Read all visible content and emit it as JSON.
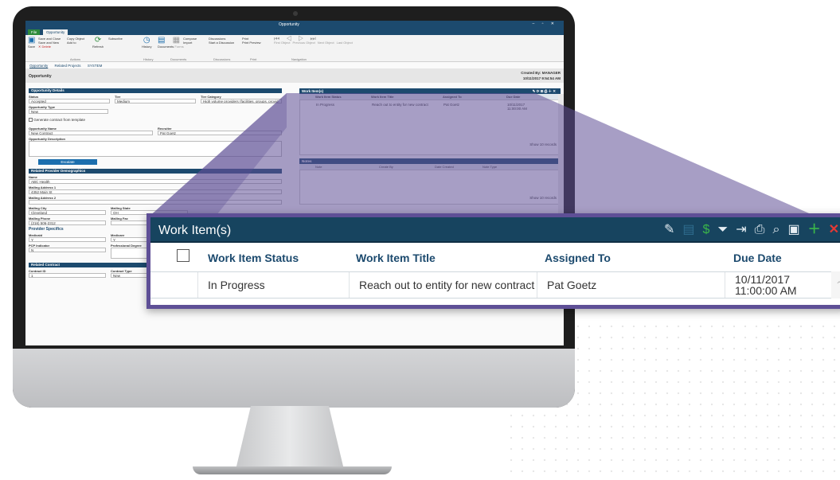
{
  "app": {
    "window_title": "Opportunity",
    "tabs": {
      "file": "File",
      "opportunity": "Opportunity"
    },
    "ribbon": {
      "save": "Save",
      "save_close": "Save and Close",
      "copy_object": "Copy Object",
      "subscribe": "Subscribe",
      "save_new": "Save and New",
      "add_to": "Add to",
      "delete": "Delete",
      "refresh": "Refresh",
      "history": "History",
      "documents": "Documents",
      "forms": "Forms",
      "compose": "Compose",
      "import": "Import",
      "discussions": "Discussions",
      "start_discussion": "Start a Discussion",
      "print": "Print",
      "print_preview": "Print Preview",
      "first_object": "First Object",
      "previous_object": "Previous Object",
      "next_object": "Next Object",
      "last_object": "Last Object",
      "groups": {
        "actions": "Actions",
        "history": "History",
        "documents": "Documents",
        "discussions": "Discussions",
        "print": "Print",
        "navigation": "Navigation"
      }
    },
    "subtabs": [
      "Opportunity",
      "Related Projects",
      "SYSTEM"
    ],
    "header": {
      "title": "Opportunity",
      "created_by": "Created By: MANAGER",
      "created_on": "10/11/2017 9:54:54 AM"
    },
    "details": {
      "section": "Opportunity Details",
      "status_label": "Status",
      "status_value": "Accepted",
      "tier_label": "Tier",
      "tier_value": "Medium",
      "tier_category_label": "Tier Category",
      "tier_category_value": "High volume providers (facilities, groups, provid",
      "type_label": "Opportunity Type",
      "type_value": "New",
      "generate_contract": "Generate contract from template",
      "name_label": "Opportunity Name",
      "name_value": "New Contract",
      "recruiter_label": "Recruiter",
      "recruiter_value": "Pat Goetz",
      "description_label": "Opportunity Description",
      "escalate_button": "Escalate"
    },
    "demographics": {
      "section": "Related Provider Demographics",
      "name_label": "Name",
      "name_value": "ABC Health",
      "address1_label": "Mailing Address 1",
      "address1_value": "4352 Main St",
      "address2_label": "Mailing Address 2",
      "city_label": "Mailing City",
      "city_value": "Cleveland",
      "state_label": "Mailing State",
      "state_value": "OH",
      "phone_label": "Mailing Phone",
      "phone_value": "(216) 506-2312",
      "fax_label": "Mailing Fax",
      "specifics_title": "Provider Specifics",
      "medicaid_label": "Medicaid",
      "medicaid_value": "Y",
      "medicare_label": "Medicare",
      "medicare_value": "Y",
      "pcp_label": "PCP Indicator",
      "pcp_value": "N",
      "degree_label": "Professional Degree"
    },
    "contract": {
      "section": "Related Contract",
      "id_label": "Contract ID",
      "id_value": "1",
      "type_label": "Contract Type",
      "type_value": "New"
    },
    "mini_work_items": {
      "title": "Work Item(s)",
      "columns": [
        "Work Item Status",
        "Work Item Title",
        "Assigned To",
        "Due Date"
      ],
      "row": [
        "In Progress",
        "Reach out to entity for new contract",
        "Pat Goetz",
        "10/11/2017 11:00:00 AM"
      ],
      "footer": "Show 10 records"
    },
    "mini_notes": {
      "title": "Notes",
      "columns": [
        "Note",
        "Create By",
        "Date Created",
        "Note Type"
      ],
      "footer": "Show 10 records"
    }
  },
  "zoom_panel": {
    "title": "Work Item(s)",
    "columns": {
      "status": "Work Item Status",
      "title": "Work Item Title",
      "assigned": "Assigned To",
      "due": "Due Date"
    },
    "row": {
      "status": "In Progress",
      "title": "Reach out to entity for new contract",
      "assigned": "Pat Goetz",
      "due_date": "10/11/2017",
      "due_time": "11:00:00 AM"
    },
    "toolbar_icons": [
      "edit-icon",
      "copy-icon",
      "refresh-icon",
      "filter-icon",
      "export-icon",
      "print-icon",
      "print-preview-icon",
      "report-icon",
      "add-icon",
      "delete-icon"
    ],
    "colors": {
      "header": "#17445f",
      "frame": "#5e4f96",
      "add": "#3ab54a",
      "delete": "#e53935"
    }
  }
}
